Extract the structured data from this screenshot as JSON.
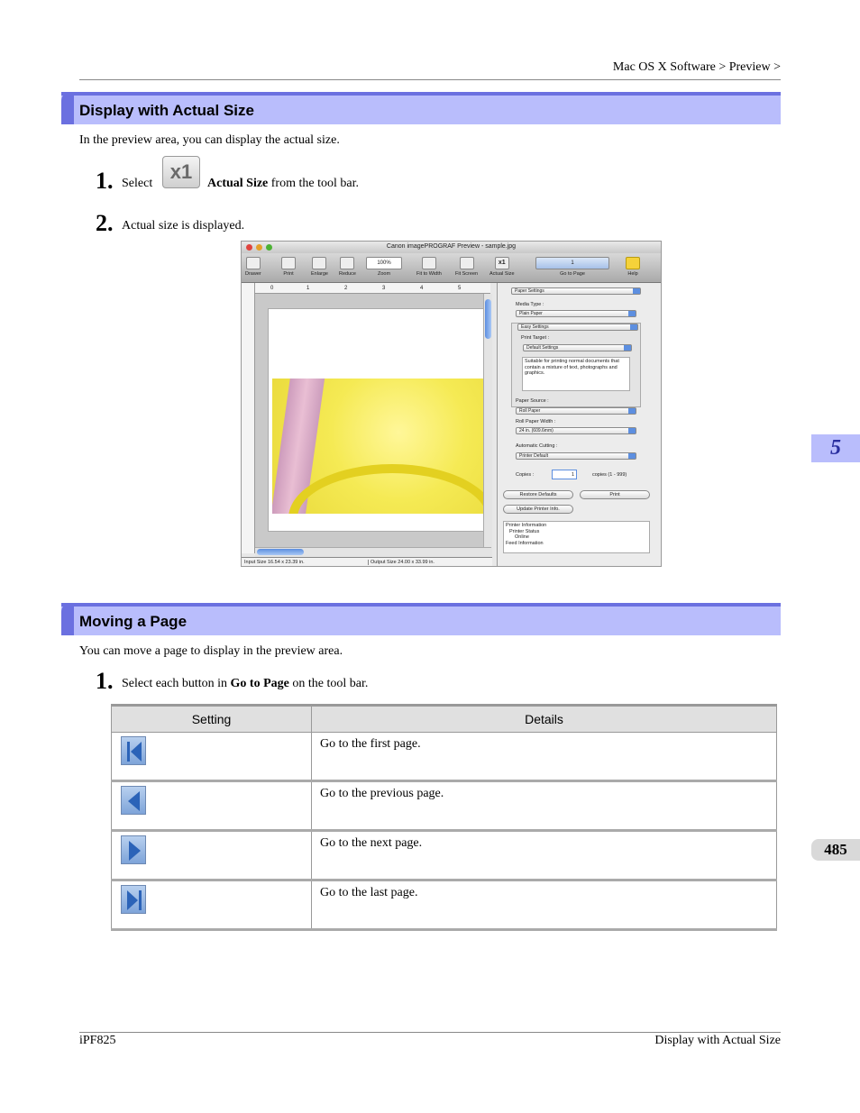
{
  "header": {
    "breadcrumb": "Mac OS X Software > Preview >"
  },
  "section1": {
    "title": "Display with Actual Size",
    "intro": "In the preview area, you can display the actual size.",
    "step1": {
      "num": "1.",
      "pre": "Select",
      "icon": "actual-size-x1-icon",
      "icon_text": "x1",
      "bold": "Actual Size",
      "post": "from the tool bar."
    },
    "step2": {
      "num": "2.",
      "text": "Actual size is displayed."
    }
  },
  "screenshot": {
    "window_title": "Canon imagePROGRAF Preview - sample.jpg",
    "toolbar": [
      "Drawer",
      "Print",
      "Enlarge",
      "Reduce",
      "Zoom",
      "Fit to Width",
      "Fit Screen",
      "Actual Size",
      "Go to Page",
      "Help"
    ],
    "zoom_value": "100%",
    "page_value": "1",
    "ruler_marks": [
      "0",
      "1",
      "2",
      "3",
      "4",
      "5"
    ],
    "status_input": "Input Size 16.54 x 23.39 in.",
    "status_output": "Output Size 24.00 x 33.99 in.",
    "panel": {
      "paper_settings": "Paper Settings",
      "media_type_label": "Media Type :",
      "media_type": "Plain Paper",
      "easy_settings": "Easy Settings",
      "print_target_label": "Print Target :",
      "print_target": "Default Settings",
      "note": "Suitable for printing normal documents that contain a mixture of text, photographs and graphics.",
      "paper_source_label": "Paper Source :",
      "paper_source": "Roll Paper",
      "roll_width_label": "Roll Paper Width :",
      "roll_width": "24 in. (609.6mm)",
      "auto_cutting_label": "Automatic Cutting :",
      "auto_cutting": "Printer Default",
      "copies_label": "Copies :",
      "copies_value": "1",
      "copies_range": "copies (1 - 999)",
      "restore_defaults": "Restore Defaults",
      "print": "Print",
      "update_info": "Update Printer Info.",
      "info_lines": [
        "Printer Information",
        "Printer Status",
        "Online",
        "Feed Information"
      ]
    }
  },
  "section2": {
    "title": "Moving a Page",
    "intro": "You can move a page to display in the preview area.",
    "step1": {
      "num": "1.",
      "pre": "Select each button in",
      "bold": "Go to Page",
      "post": "on the tool bar."
    },
    "table": {
      "headers": [
        "Setting",
        "Details"
      ],
      "rows": [
        {
          "icon": "first-page-icon",
          "details": "Go to the first page."
        },
        {
          "icon": "previous-page-icon",
          "details": "Go to the previous page."
        },
        {
          "icon": "next-page-icon",
          "details": "Go to the next page."
        },
        {
          "icon": "last-page-icon",
          "details": "Go to the last page."
        }
      ]
    }
  },
  "side_tab": "5",
  "page_number": "485",
  "footer": {
    "left": "iPF825",
    "right": "Display with Actual Size"
  },
  "colors": {
    "section_bg": "#b9bdfc",
    "section_accent": "#6b70e0"
  }
}
